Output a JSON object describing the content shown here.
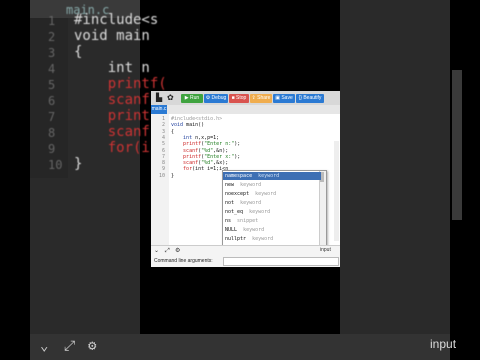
{
  "background": {
    "file_tab": "main.c",
    "line_numbers": [
      "1",
      "2",
      "3",
      "4",
      "5",
      "6",
      "7",
      "8",
      "9",
      "10"
    ],
    "code_lines": [
      "#include<s",
      "void main",
      "{",
      "    int n",
      "    printf(",
      "    scanf(",
      "    printf(",
      "    scanf(",
      "    for(i",
      "}"
    ],
    "bottom_input": "input"
  },
  "toolbar": {
    "run": "▶ Run",
    "debug": "⚙ Debug",
    "stop": "■ Stop",
    "share": "⇪ Share",
    "save": "▣ Save",
    "beautify": "{} Beautify"
  },
  "tab": "main.c",
  "editor": {
    "line_numbers": [
      "1",
      "2",
      "3",
      "4",
      "5",
      "6",
      "7",
      "8",
      "9",
      "10"
    ],
    "lines": [
      {
        "parts": [
          {
            "c": "pp",
            "t": "#include<stdio.h>"
          }
        ]
      },
      {
        "parts": [
          {
            "c": "k",
            "t": "void"
          },
          {
            "c": "",
            "t": " main()"
          }
        ]
      },
      {
        "parts": [
          {
            "c": "",
            "t": "{"
          }
        ]
      },
      {
        "parts": [
          {
            "c": "",
            "t": "    "
          },
          {
            "c": "k",
            "t": "int"
          },
          {
            "c": "",
            "t": " n,x,p=1;"
          }
        ]
      },
      {
        "parts": [
          {
            "c": "",
            "t": "    "
          },
          {
            "c": "fn",
            "t": "printf"
          },
          {
            "c": "",
            "t": "("
          },
          {
            "c": "str",
            "t": "\"Enter n:\""
          },
          {
            "c": "",
            "t": ");"
          }
        ]
      },
      {
        "parts": [
          {
            "c": "",
            "t": "    "
          },
          {
            "c": "fn",
            "t": "scanf"
          },
          {
            "c": "",
            "t": "("
          },
          {
            "c": "str",
            "t": "\"%d\""
          },
          {
            "c": "",
            "t": ",&n);"
          }
        ]
      },
      {
        "parts": [
          {
            "c": "",
            "t": "    "
          },
          {
            "c": "fn",
            "t": "printf"
          },
          {
            "c": "",
            "t": "("
          },
          {
            "c": "str",
            "t": "\"Enter x:\""
          },
          {
            "c": "",
            "t": ");"
          }
        ]
      },
      {
        "parts": [
          {
            "c": "",
            "t": "    "
          },
          {
            "c": "fn",
            "t": "scanf"
          },
          {
            "c": "",
            "t": "("
          },
          {
            "c": "str",
            "t": "\"%d\""
          },
          {
            "c": "",
            "t": ",&x);"
          }
        ]
      },
      {
        "parts": [
          {
            "c": "",
            "t": "    "
          },
          {
            "c": "fn",
            "t": "for"
          },
          {
            "c": "",
            "t": "(int i=1;i<n"
          }
        ]
      },
      {
        "parts": [
          {
            "c": "",
            "t": "}"
          }
        ]
      }
    ]
  },
  "autocomplete": [
    {
      "name": "namespace",
      "type": "keyword"
    },
    {
      "name": "new",
      "type": "keyword"
    },
    {
      "name": "noexcept",
      "type": "keyword"
    },
    {
      "name": "not",
      "type": "keyword"
    },
    {
      "name": "not_eq",
      "type": "keyword"
    },
    {
      "name": "ns",
      "type": "snippet"
    },
    {
      "name": "NULL",
      "type": "keyword"
    },
    {
      "name": "nullptr",
      "type": "keyword"
    }
  ],
  "bottom_panel": {
    "input_label": "input",
    "cmdline_label": "Command line arguments:"
  },
  "colors": {
    "run": "#3fa33f",
    "debug": "#2b7ad3",
    "stop": "#d9534f",
    "share": "#f0ad4e",
    "save": "#2b7ad3",
    "beautify": "#2b7ad3"
  }
}
